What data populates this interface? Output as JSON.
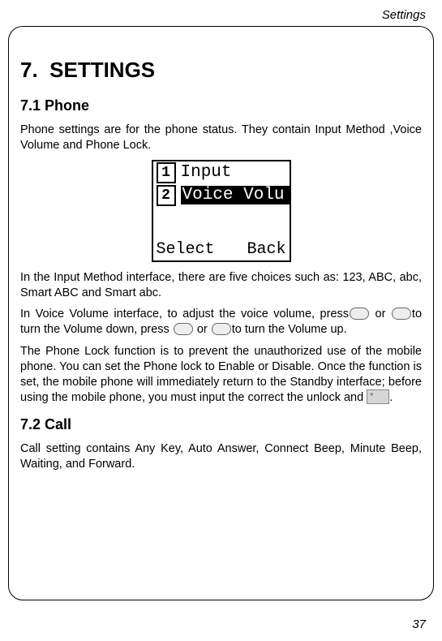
{
  "header": {
    "section_label": "Settings"
  },
  "chapter": {
    "number": "7.",
    "title": "SETTINGS"
  },
  "section_phone": {
    "heading": "7.1 Phone",
    "intro": "Phone settings are for the phone status. They contain Input Method ,Voice Volume and Phone Lock.",
    "lcd": {
      "item1_num": "1",
      "item1_label": "Input",
      "item2_num": "2",
      "item2_label": "Voice Volu",
      "soft_left": "Select",
      "soft_right": "Back"
    },
    "para_input": "In the Input Method interface, there are five choices such as: 123, ABC, abc, Smart ABC and Smart abc.",
    "para_volume_a": "In Voice Volume interface, to adjust the voice volume, press",
    "para_volume_b": " or ",
    "para_volume_c": "to turn the Volume down, press ",
    "para_volume_d": " or ",
    "para_volume_e": "to turn the Volume up.",
    "para_lock_a": "The Phone Lock function is to prevent the unauthorized use of the mobile phone. You can set the Phone lock to Enable or Disable. Once the function is set, the mobile phone will immediately return to the Standby interface; before using the mobile phone, you must input the correct the unlock and ",
    "para_lock_b": ".",
    "star_key": "*"
  },
  "section_call": {
    "heading": "7.2 Call",
    "para": "Call setting contains   Any Key, Auto Answer, Connect Beep, Minute Beep, Waiting, and Forward."
  },
  "footer": {
    "page_number": "37"
  }
}
